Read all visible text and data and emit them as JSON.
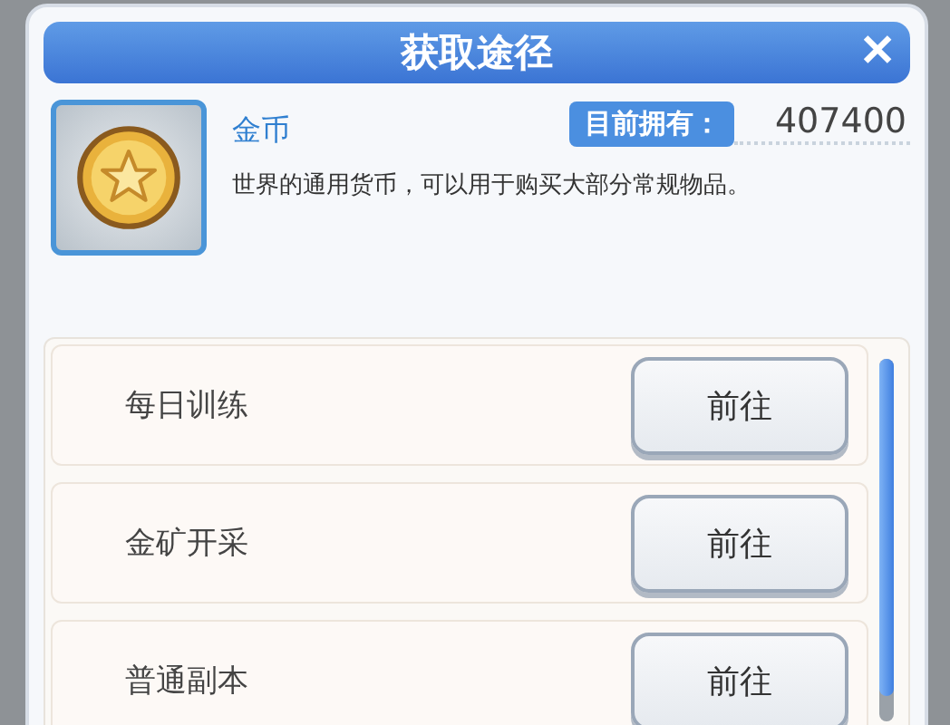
{
  "dialog": {
    "title": "获取途径",
    "close": "✕"
  },
  "item": {
    "name": "金币",
    "owned_label": "目前拥有：",
    "owned_value": "407400",
    "description": "世界的通用货币，可以用于购买大部分常规物品。"
  },
  "sources": [
    {
      "label": "每日训练",
      "button": "前往"
    },
    {
      "label": "金矿开采",
      "button": "前往"
    },
    {
      "label": "普通副本",
      "button": "前往"
    }
  ]
}
